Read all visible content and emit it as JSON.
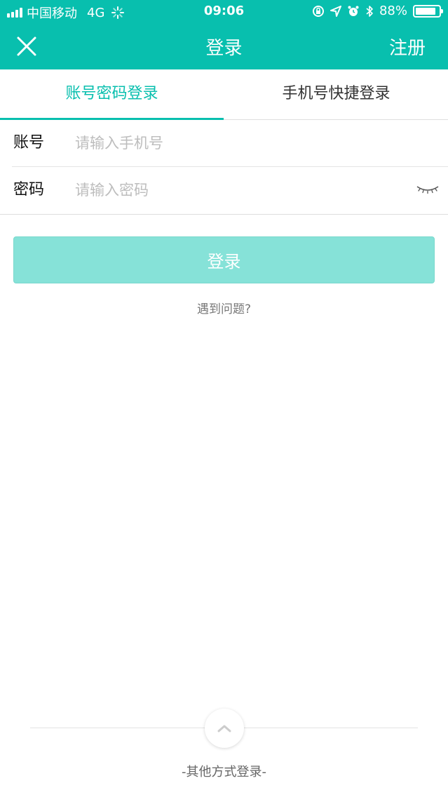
{
  "status_bar": {
    "carrier": "中国移动",
    "network": "4G",
    "time": "09:06",
    "battery_percent": "88%",
    "battery_level": 0.88
  },
  "nav": {
    "title": "登录",
    "register_label": "注册",
    "close_icon": "close-icon"
  },
  "tabs": [
    {
      "label": "账号密码登录",
      "active": true
    },
    {
      "label": "手机号快捷登录",
      "active": false
    }
  ],
  "form": {
    "account_label": "账号",
    "account_placeholder": "请输入手机号",
    "password_label": "密码",
    "password_placeholder": "请输入密码",
    "eye_icon": "eye-closed-icon"
  },
  "login_button_label": "登录",
  "trouble_link": "遇到问题?",
  "other_login_label": "-其他方式登录-",
  "colors": {
    "brand": "#08bfae",
    "button_disabled": "#86e2d8"
  }
}
